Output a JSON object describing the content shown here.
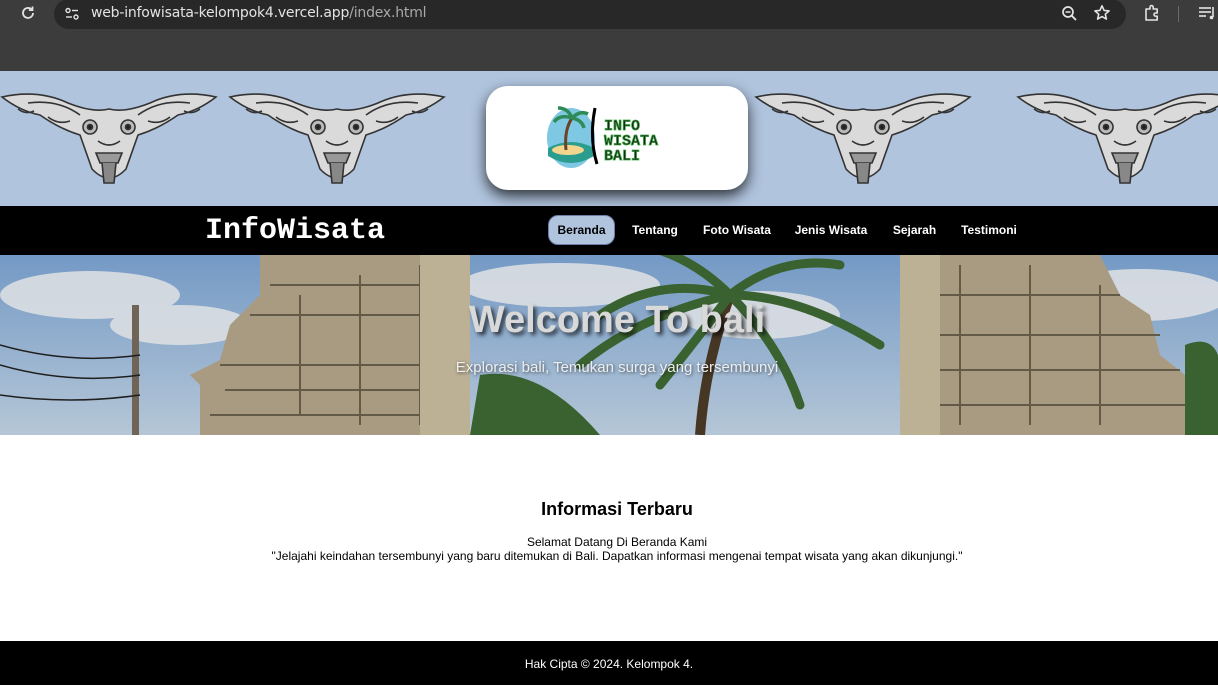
{
  "browser": {
    "url_host": "web-infowisata-kelompok4.vercel.app",
    "url_path": "/index.html"
  },
  "logo": {
    "lines": [
      "INFO",
      "WISATA",
      "BALI"
    ]
  },
  "navbar": {
    "brand": "InfoWisata",
    "items": [
      {
        "label": "Beranda",
        "active": true
      },
      {
        "label": "Tentang"
      },
      {
        "label": "Foto Wisata"
      },
      {
        "label": "Jenis Wisata"
      },
      {
        "label": "Sejarah"
      },
      {
        "label": "Testimoni"
      }
    ]
  },
  "hero": {
    "title": "Welcome To bali",
    "subtitle": "Explorasi bali, Temukan surga yang tersembunyi"
  },
  "info": {
    "heading": "Informasi Terbaru",
    "line1": "Selamat Datang Di Beranda Kami",
    "line2": "\"Jelajahi keindahan tersembunyi yang baru ditemukan di Bali. Dapatkan informasi mengenai tempat wisata yang akan dikunjungi.\""
  },
  "footer": {
    "text": "Hak Cipta © 2024. Kelompok 4."
  },
  "colors": {
    "banner": "#b0c4de",
    "navbar": "#000000",
    "active_nav": "#b0c4de"
  }
}
